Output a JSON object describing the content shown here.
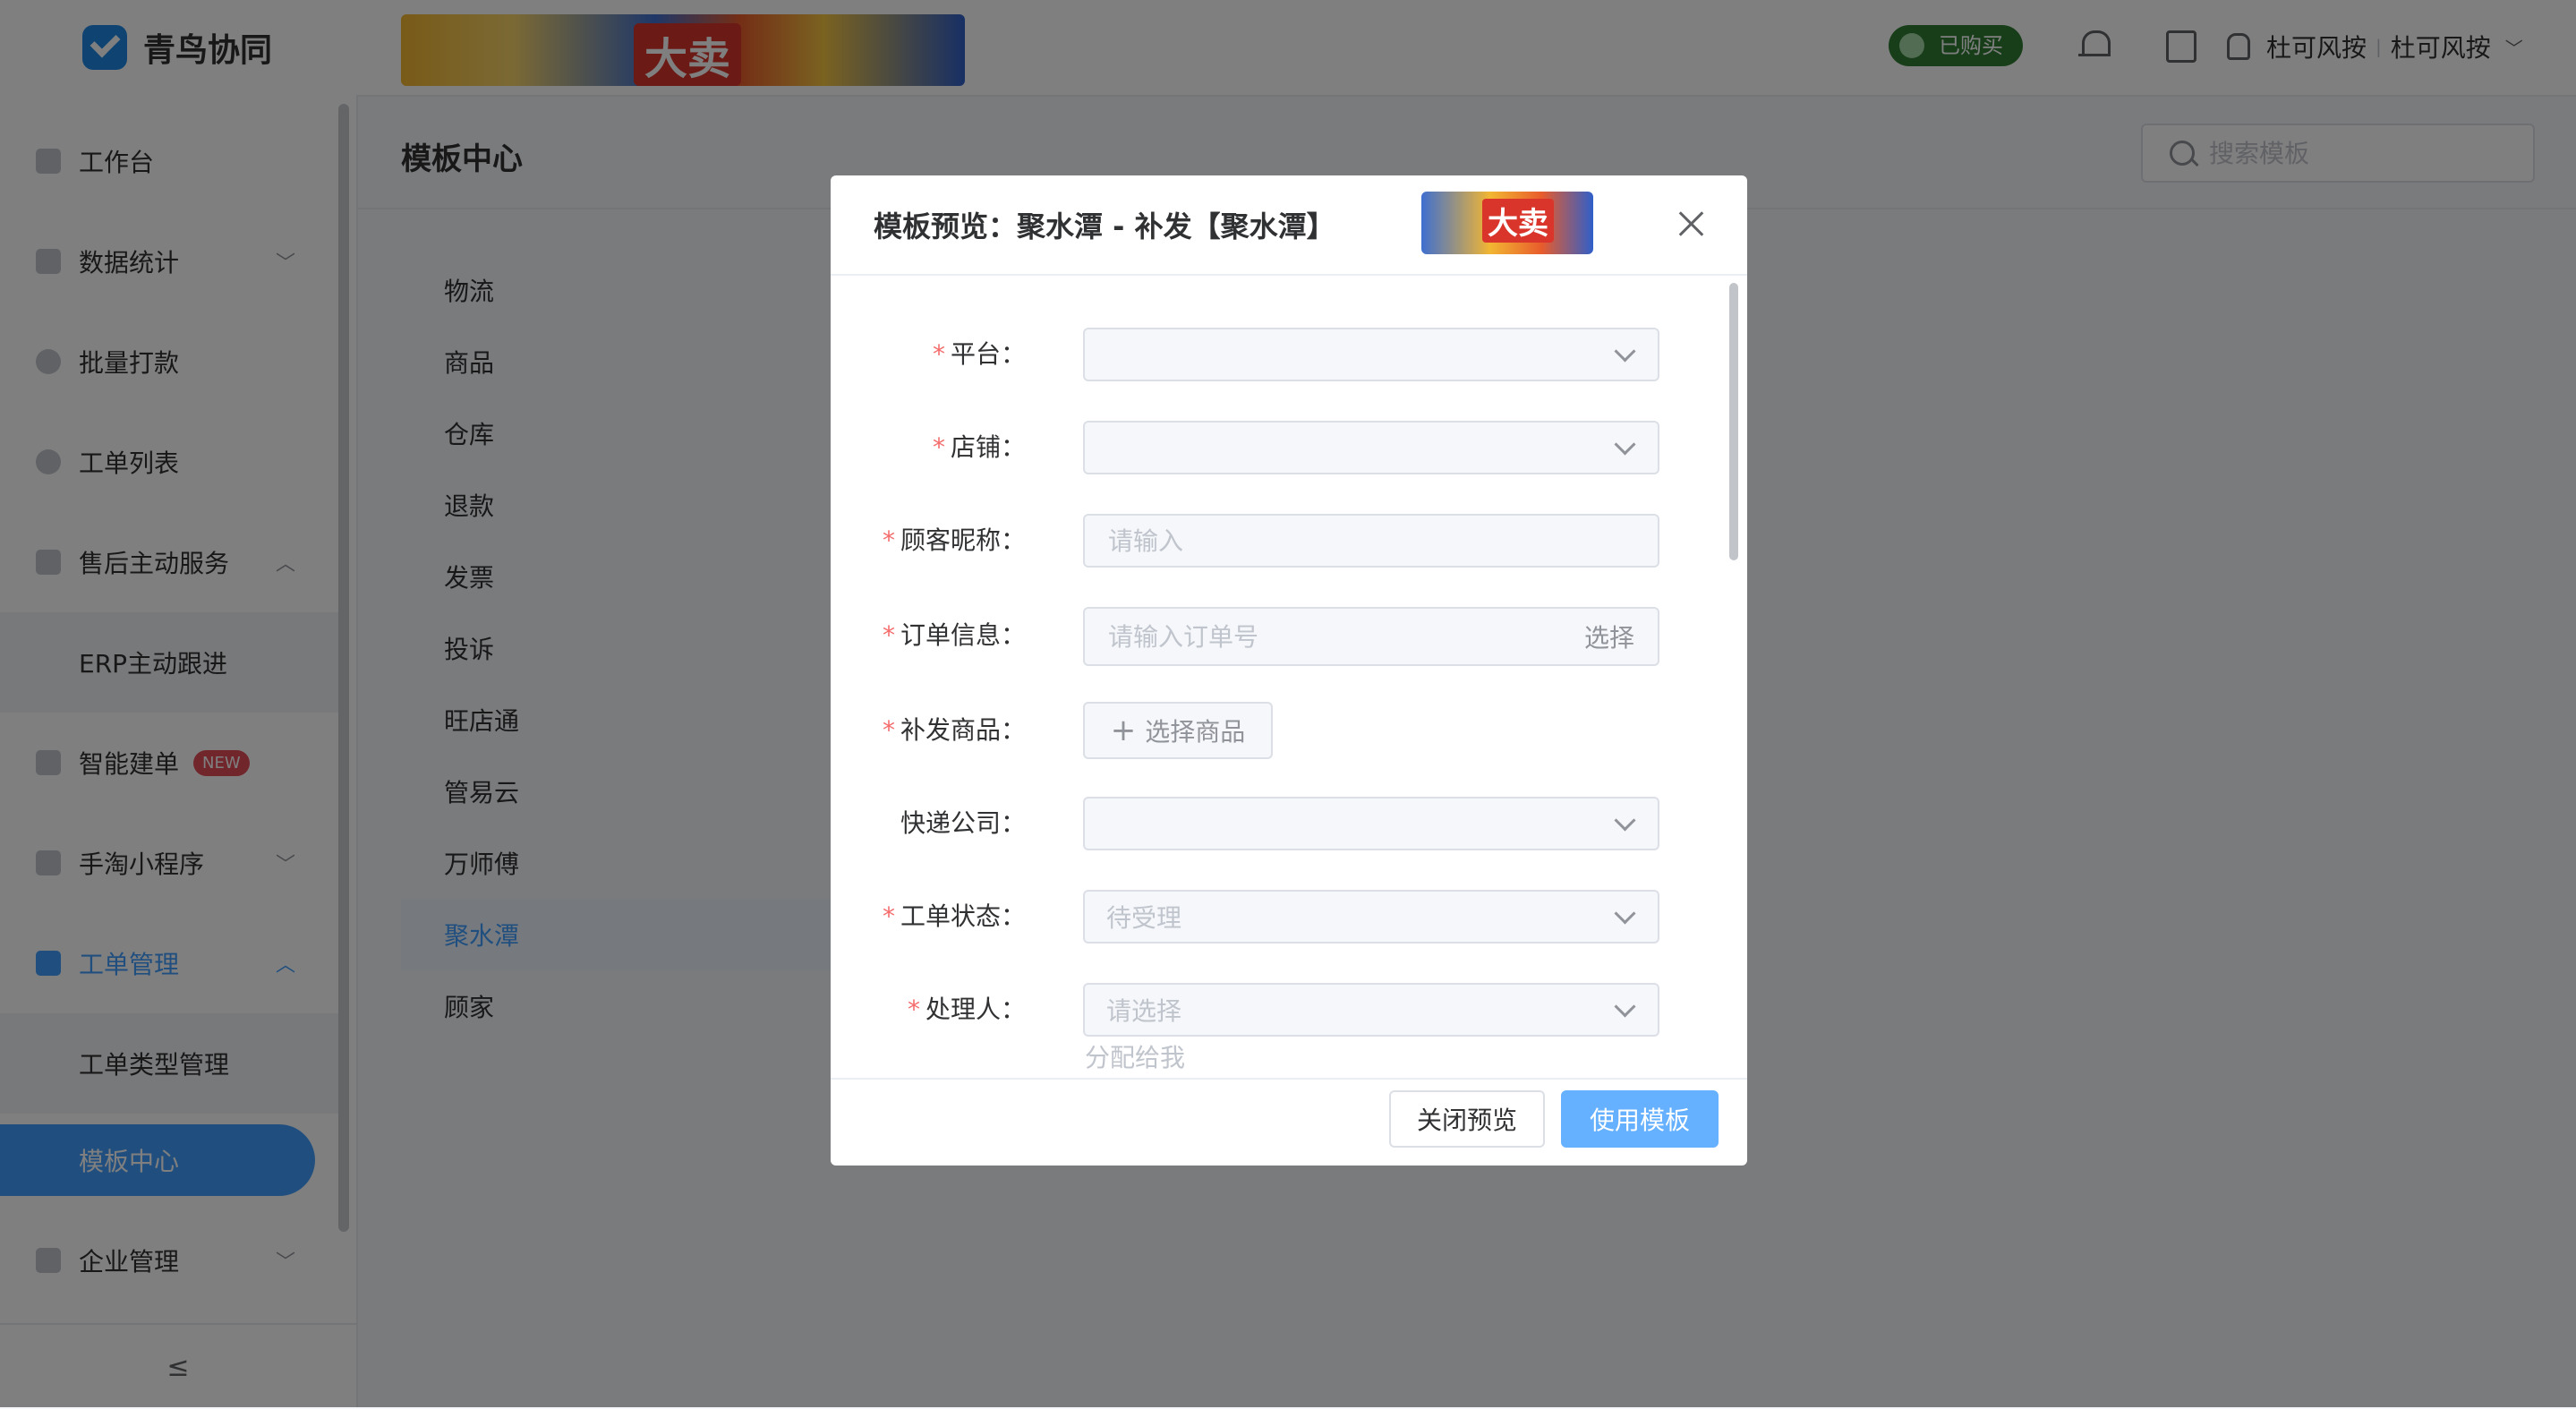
{
  "app": {
    "name": "青鸟协同"
  },
  "sidebar": {
    "items": [
      {
        "label": "工作台",
        "icon": "monitor-icon"
      },
      {
        "label": "数据统计",
        "icon": "bar-chart-icon",
        "chevron": "﹀"
      },
      {
        "label": "批量打款",
        "icon": "coin-icon"
      },
      {
        "label": "工单列表",
        "icon": "search-icon"
      },
      {
        "label": "售后主动服务",
        "icon": "message-icon",
        "chevron": "︿"
      },
      {
        "label": "ERP主动跟进"
      },
      {
        "label": "智能建单",
        "icon": "document-icon",
        "badge": "NEW"
      },
      {
        "label": "手淘小程序",
        "icon": "clipboard-icon",
        "chevron": "﹀"
      },
      {
        "label": "工单管理",
        "icon": "ticket-icon",
        "chevron": "︿"
      },
      {
        "label": "工单类型管理"
      },
      {
        "label": "模板中心"
      },
      {
        "label": "企业管理",
        "icon": "building-icon",
        "chevron": "﹀"
      }
    ],
    "collapse_icon": "≤"
  },
  "header": {
    "banner_text": "大卖",
    "bought_badge": "已购买",
    "user": "杜可风按",
    "org": "杜可风按",
    "separator": "|",
    "user_chevron": "﹀"
  },
  "main": {
    "title": "模板中心",
    "search_placeholder": "搜索模板",
    "categories": [
      "物流",
      "商品",
      "仓库",
      "退款",
      "发票",
      "投诉",
      "旺店通",
      "管易云",
      "万师傅",
      "聚水潭",
      "顾家"
    ],
    "active_category": "聚水潭"
  },
  "dialog": {
    "title": "模板预览：聚水潭 - 补发【聚水潭】",
    "banner_text": "大卖",
    "fields": [
      {
        "label": "平台：",
        "required": "*",
        "type": "select",
        "value": ""
      },
      {
        "label": "店铺：",
        "required": "*",
        "type": "select",
        "value": ""
      },
      {
        "label": "顾客昵称：",
        "required": "*",
        "type": "input",
        "placeholder": "请输入"
      },
      {
        "label": "订单信息：",
        "required": "*",
        "type": "input",
        "placeholder": "请输入订单号",
        "action": "选择"
      },
      {
        "label": "补发商品：",
        "required": "*",
        "type": "button",
        "button": "选择商品"
      },
      {
        "label": "快递公司：",
        "required": "",
        "type": "select",
        "value": ""
      },
      {
        "label": "工单状态：",
        "required": "*",
        "type": "select",
        "value": "待受理"
      },
      {
        "label": "处理人：",
        "required": "*",
        "type": "select",
        "value": "请选择"
      }
    ],
    "assign_link": "分配给我",
    "cancel": "关闭预览",
    "confirm": "使用模板"
  },
  "colors": {
    "primary": "#409eff",
    "primary_light": "#66b1ff",
    "required": "#f56c6c",
    "bought": "#2e7d32"
  }
}
